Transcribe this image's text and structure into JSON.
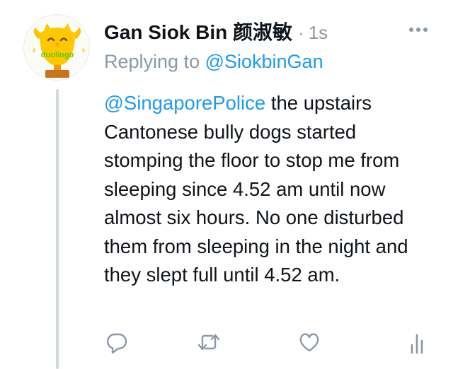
{
  "tweet": {
    "author_name": "Gan Siok Bin 颜淑敏",
    "separator": "·",
    "timestamp": "1s",
    "replying_prefix": "Replying to ",
    "replying_to": "@SiokbinGan",
    "mention": "@SingaporePolice",
    "text": " the upstairs Cantonese bully dogs started stomping the floor to stop me from sleeping since 4.52 am until now almost six hours. No one disturbed them from sleeping in the night and they slept full until 4.52 am.",
    "avatar_brand": "duolingo"
  },
  "icons": {
    "more": "more-horizontal-icon",
    "reply": "reply-icon",
    "retweet": "retweet-icon",
    "like": "heart-icon",
    "analytics": "analytics-icon"
  },
  "colors": {
    "link": "#1d9bf0",
    "muted": "#8b98a5",
    "text": "#0f1419",
    "thread_line": "#cfd9de"
  }
}
